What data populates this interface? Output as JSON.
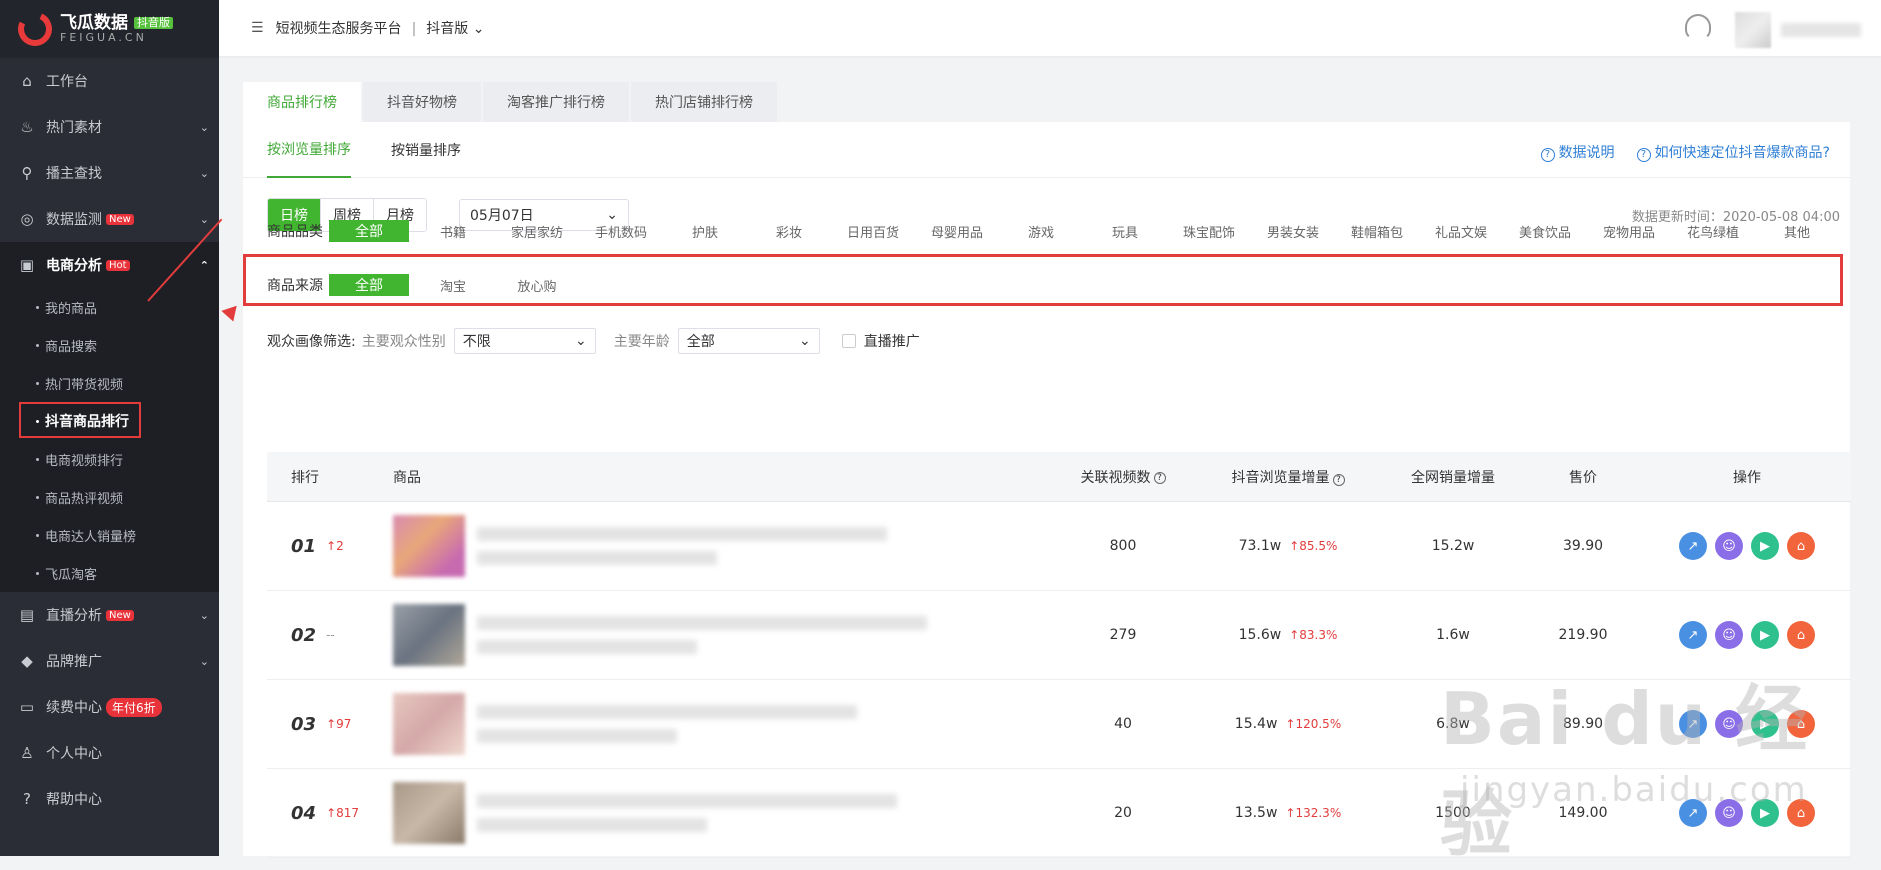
{
  "app": {
    "logo_name": "飞瓜数据",
    "logo_badge": "抖音版",
    "logo_sub": "FEIGUA.CN",
    "breadcrumb": "短视频生态服务平台",
    "platform": "抖音版"
  },
  "sidebar": {
    "items": [
      {
        "label": "工作台",
        "icon": "home-icon"
      },
      {
        "label": "热门素材",
        "icon": "fire-icon"
      },
      {
        "label": "播主查找",
        "icon": "search-icon"
      },
      {
        "label": "数据监测",
        "icon": "monitor-icon",
        "tag": "New"
      },
      {
        "label": "电商分析",
        "icon": "shop-bag-icon",
        "tag": "Hot"
      },
      {
        "label": "直播分析",
        "icon": "live-icon",
        "tag": "New"
      },
      {
        "label": "品牌推广",
        "icon": "diamond-icon"
      },
      {
        "label": "续费中心",
        "icon": "card-icon",
        "tag": "年付6折"
      },
      {
        "label": "个人中心",
        "icon": "user-icon"
      },
      {
        "label": "帮助中心",
        "icon": "help-icon"
      }
    ],
    "sub_items": [
      "我的商品",
      "商品搜索",
      "热门带货视频",
      "抖音商品排行",
      "电商视频排行",
      "商品热评视频",
      "电商达人销量榜",
      "飞瓜淘客"
    ]
  },
  "tabs": [
    "商品排行榜",
    "抖音好物榜",
    "淘客推广排行榜",
    "热门店铺排行榜"
  ],
  "sort": {
    "options": [
      "按浏览量排序",
      "按销量排序"
    ],
    "help1": "数据说明",
    "help2": "如何快速定位抖音爆款商品?"
  },
  "period": {
    "options": [
      "日榜",
      "周榜",
      "月榜"
    ],
    "date": "05月07日",
    "update_time": "数据更新时间：2020-05-08 04:00"
  },
  "filters": {
    "category_label": "商品品类",
    "categories": [
      "全部",
      "书籍",
      "家居家纺",
      "手机数码",
      "护肤",
      "彩妆",
      "日用百货",
      "母婴用品",
      "游戏",
      "玩具",
      "珠宝配饰",
      "男装女装",
      "鞋帽箱包",
      "礼品文娱",
      "美食饮品",
      "宠物用品",
      "花鸟绿植",
      "其他"
    ],
    "source_label": "商品来源",
    "sources": [
      "全部",
      "淘宝",
      "放心购"
    ],
    "audience_label": "观众画像筛选:",
    "gender_label": "主要观众性别",
    "gender_value": "不限",
    "age_label": "主要年龄",
    "age_value": "全部",
    "live_label": "直播推广"
  },
  "table": {
    "headers": [
      "排行",
      "商品",
      "关联视频数",
      "抖音浏览量增量",
      "全网销量增量",
      "售价",
      "操作"
    ],
    "rows": [
      {
        "rank": "01",
        "change": "↑2",
        "videos": "800",
        "views": "73.1w",
        "growth": "↑85.5%",
        "sales": "15.2w",
        "price": "39.90"
      },
      {
        "rank": "02",
        "change": "--",
        "videos": "279",
        "views": "15.6w",
        "growth": "↑83.3%",
        "sales": "1.6w",
        "price": "219.90"
      },
      {
        "rank": "03",
        "change": "↑97",
        "videos": "40",
        "views": "15.4w",
        "growth": "↑120.5%",
        "sales": "6.8w",
        "price": "89.90"
      },
      {
        "rank": "04",
        "change": "↑817",
        "videos": "20",
        "views": "13.5w",
        "growth": "↑132.3%",
        "sales": "1500",
        "price": "149.00"
      }
    ]
  },
  "watermark": {
    "main": "Bai du 经验",
    "sub": "jingyan.baidu.com"
  }
}
